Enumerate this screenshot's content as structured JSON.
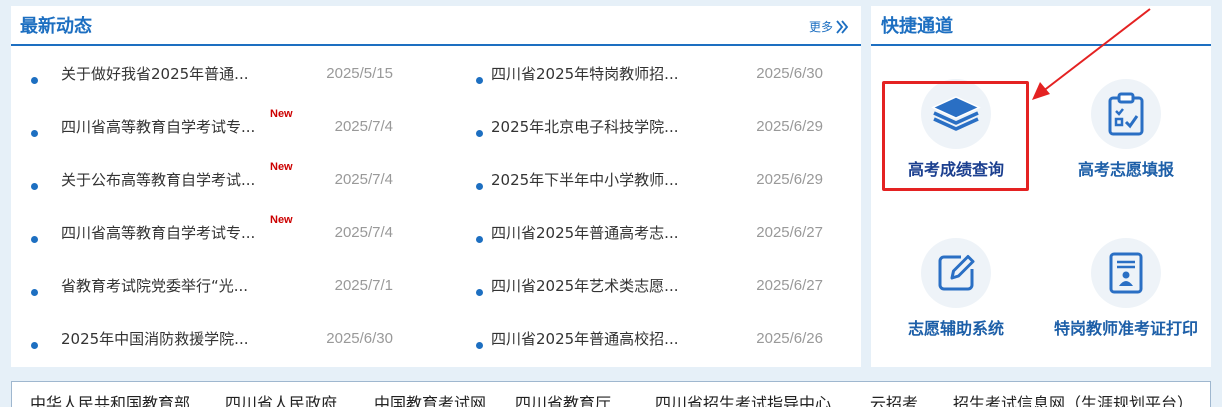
{
  "news": {
    "title": "最新动态",
    "more_label": "更多",
    "new_badge": "New",
    "left": [
      {
        "title": "关于做好我省2025年普通...",
        "date": "2025/5/15",
        "is_new": false
      },
      {
        "title": "四川省高等教育自学考试专...",
        "date": "2025/7/4",
        "is_new": true
      },
      {
        "title": "关于公布高等教育自学考试...",
        "date": "2025/7/4",
        "is_new": true
      },
      {
        "title": "四川省高等教育自学考试专...",
        "date": "2025/7/4",
        "is_new": true
      },
      {
        "title": "省教育考试院党委举行“光...",
        "date": "2025/7/1",
        "is_new": false
      },
      {
        "title": "2025年中国消防救援学院...",
        "date": "2025/6/30",
        "is_new": false
      }
    ],
    "right": [
      {
        "title": "四川省2025年特岗教师招...",
        "date": "2025/6/30"
      },
      {
        "title": "2025年北京电子科技学院...",
        "date": "2025/6/29"
      },
      {
        "title": "2025年下半年中小学教师...",
        "date": "2025/6/29"
      },
      {
        "title": "四川省2025年普通高考志...",
        "date": "2025/6/27"
      },
      {
        "title": "四川省2025年艺术类志愿...",
        "date": "2025/6/27"
      },
      {
        "title": "四川省2025年普通高校招...",
        "date": "2025/6/26"
      }
    ]
  },
  "quick": {
    "title": "快捷通道",
    "items": [
      {
        "label": "高考成绩查询",
        "icon": "layers-icon"
      },
      {
        "label": "高考志愿填报",
        "icon": "clipboard-check-icon"
      },
      {
        "label": "志愿辅助系统",
        "icon": "edit-icon"
      },
      {
        "label": "特岗教师准考证打印",
        "icon": "id-card-icon"
      }
    ]
  },
  "links": [
    "中华人民共和国教育部",
    "四川省人民政府",
    "中国教育考试网",
    "四川省教育厅",
    "四川省招生考试指导中心",
    "云招考",
    "招生考试信息网（生涯规划平台）"
  ],
  "colors": {
    "accent": "#1d6fc1",
    "highlight": "#e42222",
    "new_badge": "#cc0000"
  }
}
